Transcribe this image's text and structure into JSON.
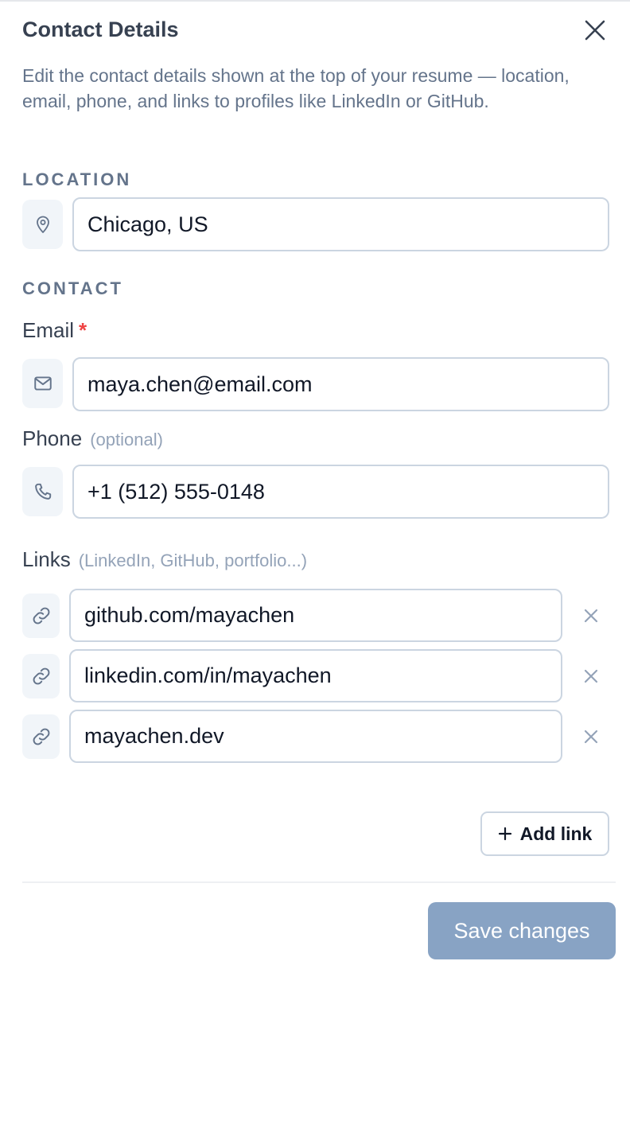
{
  "dialog": {
    "title": "Contact Details",
    "description": "Edit the contact details shown at the top of your resume — location, email, phone, and links to profiles like LinkedIn or GitHub."
  },
  "location": {
    "section_label": "LOCATION",
    "value": "Chicago, US",
    "icon": "map-pin-icon"
  },
  "contact": {
    "section_label": "CONTACT",
    "email": {
      "label": "Email",
      "required_mark": "*",
      "value": "maya.chen@email.com",
      "icon": "mail-icon"
    },
    "phone": {
      "label": "Phone",
      "hint": "(optional)",
      "value": "+1 (512) 555-0148",
      "icon": "phone-icon"
    }
  },
  "links": {
    "label": "Links",
    "hint": "(LinkedIn, GitHub, portfolio...)",
    "items": [
      {
        "value": "github.com/mayachen",
        "icon": "link-icon"
      },
      {
        "value": "linkedin.com/in/mayachen",
        "icon": "link-icon"
      },
      {
        "value": "mayachen.dev",
        "icon": "link-icon"
      }
    ],
    "add_label": "Add link"
  },
  "footer": {
    "save_label": "Save changes",
    "save_color": "#88a3c4"
  },
  "colors": {
    "required": "#ef4444",
    "muted_text": "#64748b",
    "border": "#cbd5e1"
  }
}
